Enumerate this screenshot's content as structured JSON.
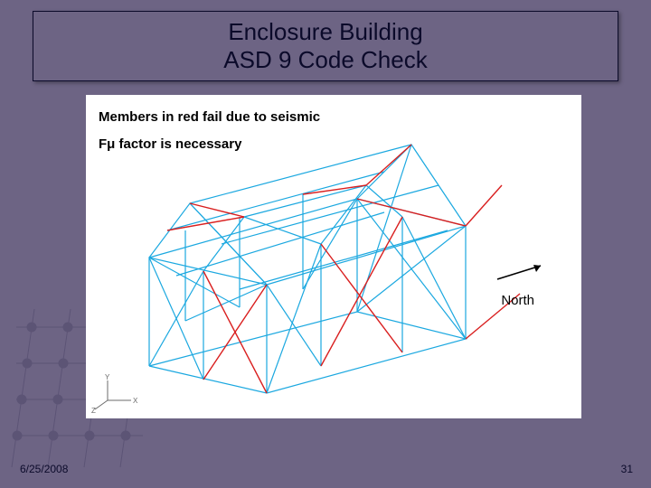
{
  "title": {
    "line1": "Enclosure Building",
    "line2": "ASD 9 Code Check"
  },
  "figure": {
    "note1": "Members in red fail due to seismic",
    "note2": "Fμ factor is necessary",
    "north_label": "North",
    "axes": {
      "x": "X",
      "y": "Y",
      "z": "Z"
    }
  },
  "footer": {
    "date": "6/25/2008",
    "page": "31"
  }
}
